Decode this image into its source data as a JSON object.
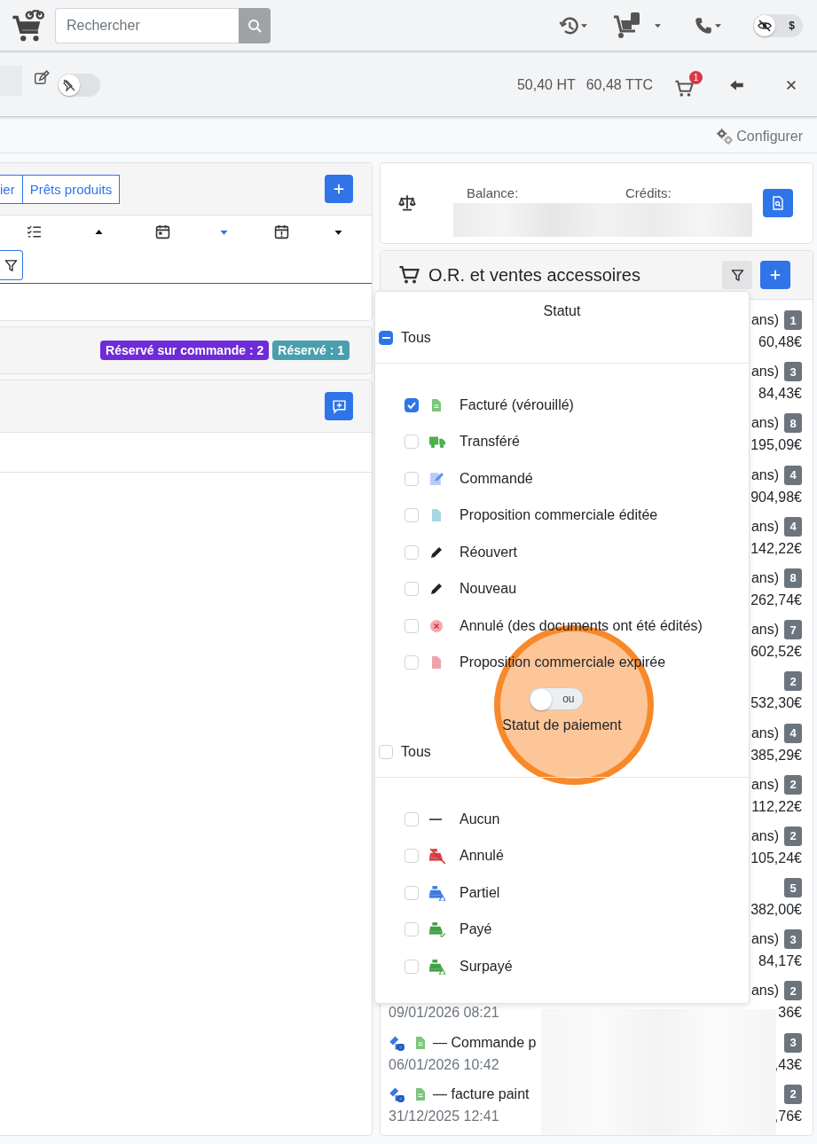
{
  "topbar": {
    "search": {
      "placeholder": "Rechercher"
    },
    "view_toggle": {
      "label": "$",
      "on": false
    }
  },
  "subbar": {
    "pin_toggle": {
      "on": false
    },
    "total_ht": "50,40 HT",
    "total_ttc": "60,48 TTC",
    "cart_count": "1"
  },
  "config_bar": {
    "label": "Configurer"
  },
  "left": {
    "tabs": [
      {
        "label": "ier",
        "selected": false
      },
      {
        "label": "Prêts produits",
        "selected": false
      }
    ],
    "sort_columns": [
      {
        "kind": "checklist",
        "ascending": true,
        "selected": false
      },
      {
        "kind": "calendar",
        "ascending": false,
        "selected": true
      },
      {
        "kind": "calendar-alert",
        "ascending": false,
        "selected": false
      }
    ],
    "reservations": [
      {
        "label": "Réservé sur commande : 2",
        "color": "#6f2bd8"
      },
      {
        "label": "Réservé : 1",
        "color": "#4a9fae"
      }
    ]
  },
  "balance": {
    "balance_label": "Balance:",
    "credits_label": "Crédits:"
  },
  "orders": {
    "title": "O.R. et ventes accessoires",
    "rows": [
      {
        "suffix": "ans)",
        "count": "1",
        "amount": "60,48€"
      },
      {
        "suffix": "ans)",
        "count": "3",
        "amount": "84,43€"
      },
      {
        "suffix": "ans)",
        "count": "8",
        "amount": "195,09€"
      },
      {
        "suffix": "ans)",
        "count": "4",
        "amount": "904,98€"
      },
      {
        "suffix": "ans)",
        "count": "4",
        "amount": "142,22€"
      },
      {
        "suffix": "ans)",
        "count": "8",
        "amount": "262,74€"
      },
      {
        "suffix": "ans)",
        "count": "7",
        "amount": "602,52€"
      },
      {
        "count": "2",
        "amount": "532,30€"
      },
      {
        "suffix": "ans)",
        "count": "4",
        "amount": "385,29€"
      },
      {
        "suffix": "ans)",
        "count": "2",
        "amount": "112,22€"
      },
      {
        "suffix": "ans)",
        "count": "2",
        "amount": "105,24€"
      },
      {
        "count": "5",
        "amount": "382,00€"
      },
      {
        "suffix": "ans)",
        "count": "3",
        "amount": "84,17€"
      },
      {
        "suffix": "ans)",
        "count": "2",
        "amount": "36€",
        "date": "09/01/2026 08:21"
      },
      {
        "title": "— Commande p",
        "count": "3",
        "amount": ",43€",
        "date": "06/01/2026 10:42"
      },
      {
        "title": "— facture paint",
        "count": "2",
        "amount": ",76€",
        "date": "31/12/2025 12:41"
      }
    ]
  },
  "filter": {
    "status": {
      "title": "Statut",
      "all": {
        "label": "Tous",
        "indeterminate": true
      },
      "items": [
        {
          "label": "Facturé (vérouillé)",
          "kind": "invoiced",
          "checked": true
        },
        {
          "label": "Transféré",
          "kind": "transferred",
          "checked": false
        },
        {
          "label": "Commandé",
          "kind": "ordered",
          "checked": false
        },
        {
          "label": "Proposition commerciale éditée",
          "kind": "proposal",
          "checked": false
        },
        {
          "label": "Réouvert",
          "kind": "reopened",
          "checked": false
        },
        {
          "label": "Nouveau",
          "kind": "new",
          "checked": false
        },
        {
          "label": "Annulé (des documents ont été édités)",
          "kind": "cancelled",
          "checked": false
        },
        {
          "label": "Proposition commerciale expirée",
          "kind": "expired",
          "checked": false
        }
      ]
    },
    "mode_toggle": {
      "label": "ou",
      "on": false
    },
    "payment": {
      "title": "Statut de paiement",
      "all": {
        "label": "Tous",
        "checked": false,
        "indeterminate": false
      },
      "items": [
        {
          "label": "Aucun",
          "kind": "none",
          "checked": false
        },
        {
          "label": "Annulé",
          "kind": "cancelled",
          "checked": false
        },
        {
          "label": "Partiel",
          "kind": "partial",
          "checked": false
        },
        {
          "label": "Payé",
          "kind": "paid",
          "checked": false
        },
        {
          "label": "Surpayé",
          "kind": "overpaid",
          "checked": false
        }
      ]
    }
  }
}
